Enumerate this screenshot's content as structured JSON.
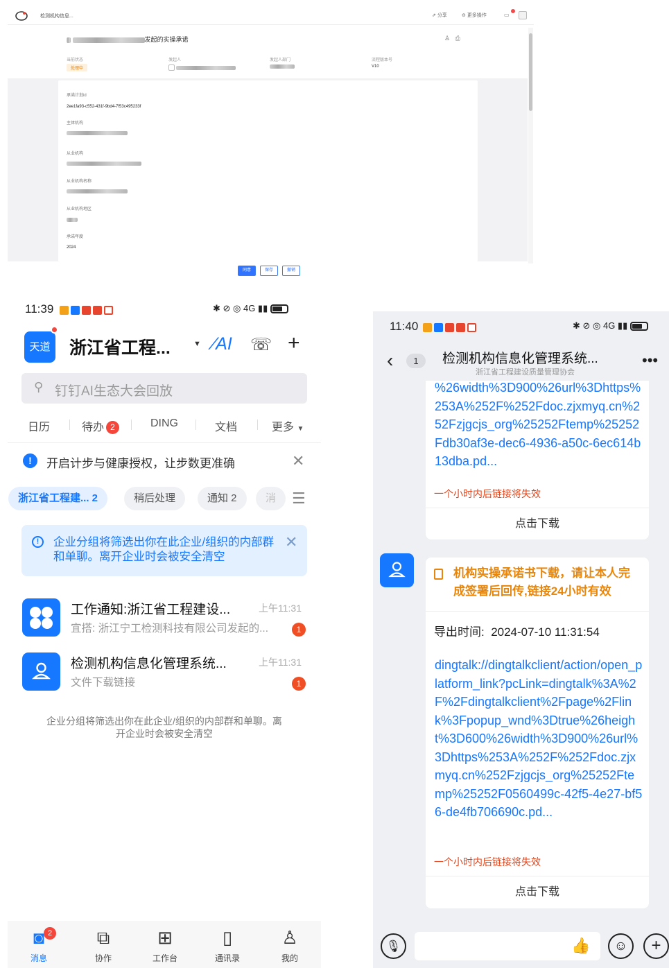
{
  "desktop": {
    "app_title": "检测机构信息...",
    "share_label": "分享",
    "more_ops_label": "更多操作",
    "record_title_suffix": "发起的实操承诺",
    "meta": [
      {
        "label": "当前状态",
        "value": "处理中"
      },
      {
        "label": "发起人",
        "value": ""
      },
      {
        "label": "发起人部门",
        "value": ""
      },
      {
        "label": "流程版本号",
        "value": "V10"
      }
    ],
    "fields": [
      {
        "label": "承诺计划id",
        "value": "2ee1fa93-c552-431f-9bd4-7f53c495233f"
      },
      {
        "label": "主体机构",
        "value": ""
      },
      {
        "label": "从业机构",
        "value": ""
      },
      {
        "label": "从业机构名称",
        "value": ""
      },
      {
        "label": "从业机构地区",
        "value": ""
      },
      {
        "label": "承诺年度",
        "value": "2024"
      }
    ],
    "buttons": {
      "approve": "同意",
      "save": "保存",
      "revoke": "撤销"
    },
    "colors": {
      "primary": "#2f73ff",
      "status": "#e8860c"
    }
  },
  "phone_left": {
    "status": {
      "time": "11:39",
      "network": "4G"
    },
    "org_logo_text": "天道",
    "org_name": "浙江省工程...",
    "search_placeholder": "钉钉AI生态大会回放",
    "quick_tabs": [
      {
        "label": "日历"
      },
      {
        "label": "待办",
        "badge": "2"
      },
      {
        "label": "DING"
      },
      {
        "label": "文档"
      },
      {
        "label": "更多"
      }
    ],
    "tip": "开启计步与健康授权，让步数更准确",
    "chips": [
      "浙江省工程建... 2",
      "稍后处理",
      "通知 2",
      "消"
    ],
    "notice": "企业分组将筛选出你在此企业/组织的内部群和单聊。离开企业时会被安全清空",
    "conversations": [
      {
        "title": "工作通知:浙江省工程建设...",
        "time": "上午11:31",
        "subtitle": "宜搭: 浙江宁工检测科技有限公司发起的...",
        "badge": "1",
        "icon": "apps-grid-icon"
      },
      {
        "title": "检测机构信息化管理系统...",
        "time": "上午11:31",
        "subtitle": "文件下载链接",
        "badge": "1",
        "icon": "bot-user-icon"
      }
    ],
    "footer_note": "企业分组将筛选出你在此企业/组织的内部群和单聊。离开企业时会被安全清空",
    "tabs": [
      {
        "label": "消息",
        "badge": "2",
        "icon": "chat-icon"
      },
      {
        "label": "协作",
        "icon": "collab-icon"
      },
      {
        "label": "工作台",
        "icon": "grid-icon"
      },
      {
        "label": "通讯录",
        "icon": "contacts-icon"
      },
      {
        "label": "我的",
        "icon": "user-icon"
      }
    ]
  },
  "phone_right": {
    "status": {
      "time": "11:40",
      "network": "4G"
    },
    "back_count": "1",
    "title": "检测机构信息化管理系统...",
    "subtitle": "浙江省工程建设质量管理协会",
    "msg1": {
      "link": "%26width%3D900%26url%3Dhttps%253A%252F%252Fdoc.zjxmyq.cn%252Fzjgcjs_org%25252Ftemp%25252Fdb30af3e-dec6-4936-a50c-6ec614b13dba.pd...",
      "warning": "一个小时内后链接将失效",
      "download": "点击下载"
    },
    "msg2": {
      "title": "机构实操承诺书下载，请让本人完成签署后回传,链接24小时有效",
      "export_label": "导出时间:",
      "export_time": "2024-07-10 11:31:54",
      "link": "dingtalk://dingtalkclient/action/open_platform_link?pcLink=dingtalk%3A%2F%2Fdingtalkclient%2Fpage%2Flink%3Fpopup_wnd%3Dtrue%26height%3D600%26width%3D900%26url%3Dhttps%253A%252F%252Fdoc.zjxmyq.cn%252Fzjgcjs_org%25252Ftemp%25252F0560499c-42f5-4e27-bf56-de4fb706690c.pd...",
      "warning": "一个小时内后链接将失效",
      "download": "点击下载"
    }
  }
}
